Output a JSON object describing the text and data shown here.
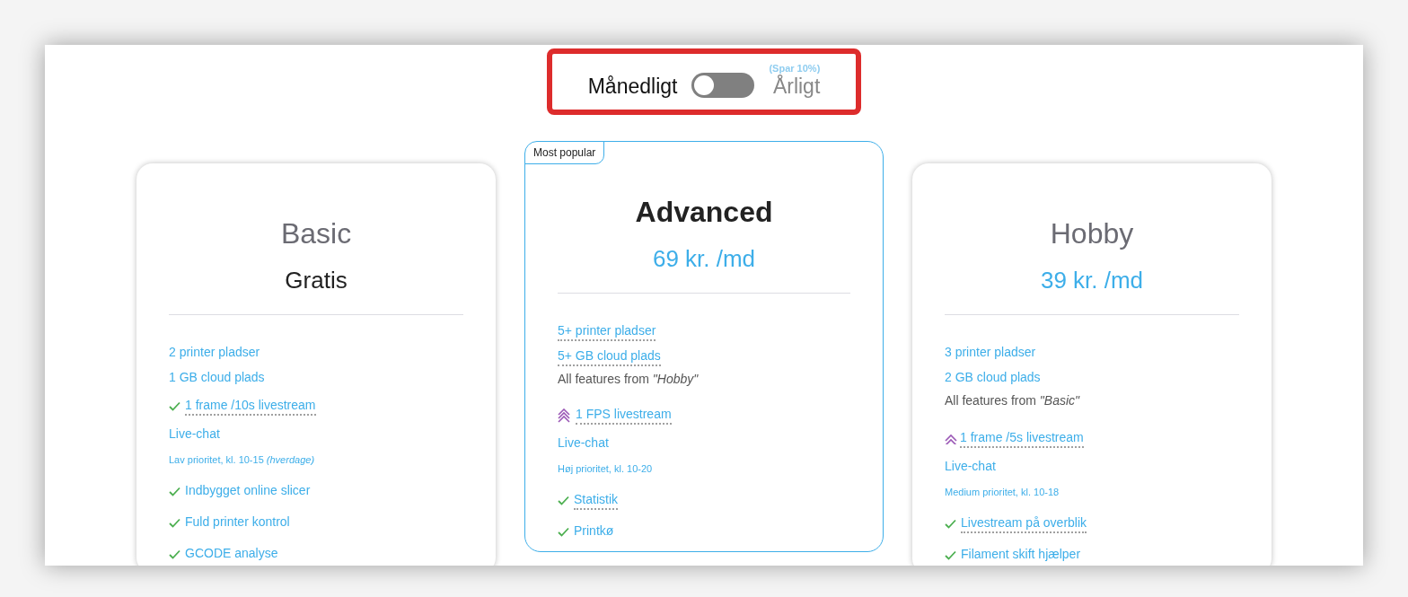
{
  "billing": {
    "monthly_label": "Månedligt",
    "yearly_label": "Årligt",
    "savings_note": "(Spar 10%)",
    "yearly": false,
    "highlighted": true
  },
  "plans": [
    {
      "name": "Basic",
      "price": "Gratis",
      "free": true,
      "featured": false,
      "features": [
        {
          "kind": "plain",
          "text": "2 printer pladser",
          "dotted": false
        },
        {
          "kind": "plain",
          "text": "1 GB cloud plads",
          "dotted": false
        },
        {
          "kind": "check",
          "text": "1 frame /10s livestream",
          "dotted": true
        },
        {
          "kind": "plain",
          "text": "Live-chat",
          "dotted": false
        },
        {
          "kind": "note",
          "text": "Lav prioritet, kl. 10-15 *(hverdage)*",
          "dotted": false
        },
        {
          "kind": "check",
          "text": "Indbygget online slicer",
          "dotted": false
        },
        {
          "kind": "check",
          "text": "Fuld printer kontrol",
          "dotted": false
        },
        {
          "kind": "check",
          "text": "GCODE analyse",
          "dotted": false
        }
      ]
    },
    {
      "name": "Advanced",
      "price": "69 kr. /md",
      "free": false,
      "featured": true,
      "badge": "Most popular",
      "features": [
        {
          "kind": "plain",
          "text": "5+ printer pladser",
          "dotted": true
        },
        {
          "kind": "plain",
          "text": "5+ GB cloud plads",
          "dotted": true
        },
        {
          "kind": "inherit",
          "text": "All features from *\"Hobby\"*",
          "dotted": false
        },
        {
          "kind": "upgrade_max",
          "text": "1 FPS livestream",
          "dotted": true
        },
        {
          "kind": "plain",
          "text": "Live-chat",
          "dotted": false
        },
        {
          "kind": "note",
          "text": "Høj prioritet, kl. 10-20",
          "dotted": false
        },
        {
          "kind": "check",
          "text": "Statistik",
          "dotted": true
        },
        {
          "kind": "check",
          "text": "Printkø",
          "dotted": false
        }
      ]
    },
    {
      "name": "Hobby",
      "price": "39 kr. /md",
      "free": false,
      "featured": false,
      "features": [
        {
          "kind": "plain",
          "text": "3 printer pladser",
          "dotted": false
        },
        {
          "kind": "plain",
          "text": "2 GB cloud plads",
          "dotted": false
        },
        {
          "kind": "inherit",
          "text": "All features from *\"Basic\"*",
          "dotted": false
        },
        {
          "kind": "upgrade",
          "text": "1 frame /5s livestream",
          "dotted": true
        },
        {
          "kind": "plain",
          "text": "Live-chat",
          "dotted": false
        },
        {
          "kind": "note",
          "text": "Medium prioritet, kl. 10-18",
          "dotted": false
        },
        {
          "kind": "check",
          "text": "Livestream på overblik",
          "dotted": true
        },
        {
          "kind": "check",
          "text": "Filament skift hjælper",
          "dotted": false
        }
      ]
    }
  ]
}
